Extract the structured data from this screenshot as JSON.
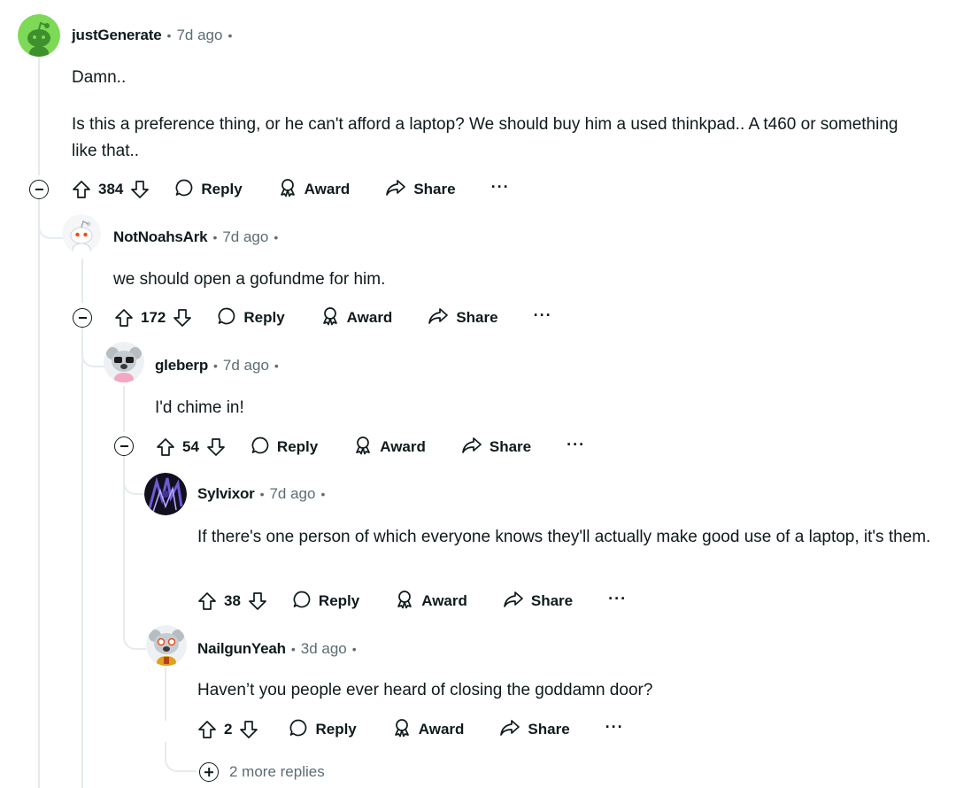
{
  "ui": {
    "dot": "•",
    "reply_label": "Reply",
    "award_label": "Award",
    "share_label": "Share",
    "more_label": "···"
  },
  "comments": [
    {
      "author": "justGenerate",
      "time": "7d ago",
      "body": [
        "Damn..",
        "Is this a preference thing, or he can't afford a laptop? We should buy him a used thinkpad.. A t460 or something like that.."
      ],
      "votes": "384"
    },
    {
      "author": "NotNoahsArk",
      "time": "7d ago",
      "body": [
        "we should open a gofundme for him."
      ],
      "votes": "172"
    },
    {
      "author": "gleberp",
      "time": "7d ago",
      "body": [
        "I'd chime in!"
      ],
      "votes": "54"
    },
    {
      "author": "Sylvixor",
      "time": "7d ago",
      "body": [
        "If there's one person of which everyone knows they'll actually make good use of a laptop, it's them."
      ],
      "votes": "38"
    },
    {
      "author": "NailgunYeah",
      "time": "3d ago",
      "body": [
        "Haven’t you people ever heard of closing the goddamn door?"
      ],
      "votes": "2"
    }
  ],
  "more_replies": "2 more replies",
  "colors": {
    "text": "#0f1a1c",
    "meta": "#5c6c74",
    "thread_line": "#e5ebee",
    "avatar_green": "#7ed957"
  }
}
